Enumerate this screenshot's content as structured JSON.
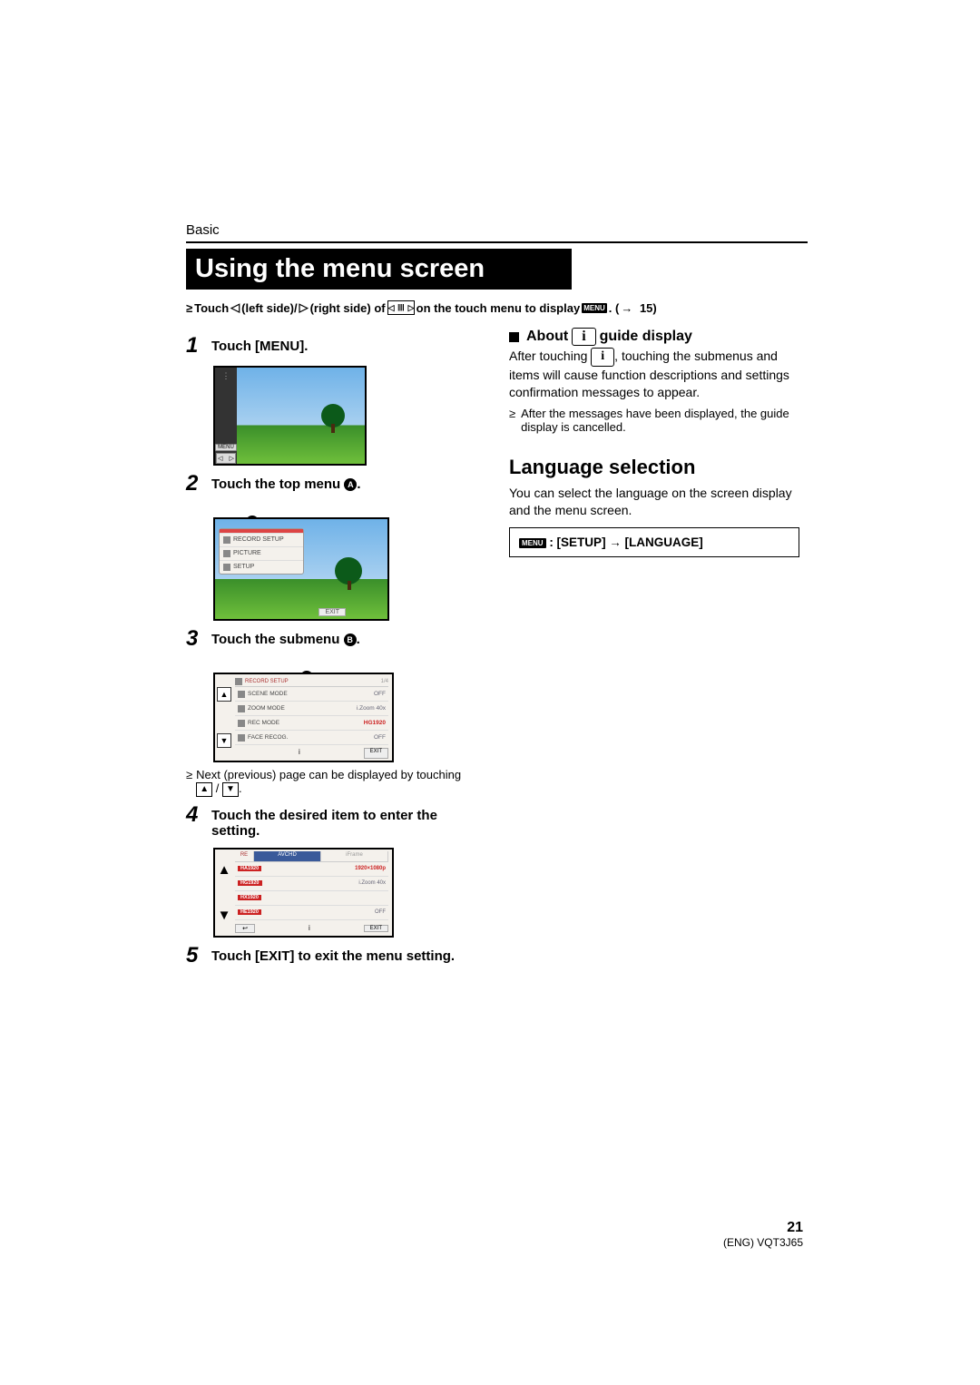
{
  "breadcrumb": "Basic",
  "title": "Using the menu screen",
  "intro": {
    "prefix": "Touch",
    "left": "(left side)/",
    "right": "(right side) of",
    "tail1": "on the touch menu to display",
    "tail2": ". (",
    "arrow": "→",
    "page_ref": "15)"
  },
  "steps": {
    "s1": {
      "num": "1",
      "text": "Touch [MENU]."
    },
    "s2": {
      "num": "2",
      "text_a": "Touch the top menu ",
      "badge": "A",
      "text_b": "."
    },
    "s3": {
      "num": "3",
      "text_a": "Touch the submenu ",
      "badge": "B",
      "text_b": ".",
      "note_a": "Next (previous) page can be displayed by touching ",
      "slash": " / ",
      "note_b": "."
    },
    "s4": {
      "num": "4",
      "text": "Touch the desired item to enter the setting."
    },
    "s5": {
      "num": "5",
      "text": "Touch [EXIT] to exit the menu setting."
    }
  },
  "fig1": {
    "menu": "MENU"
  },
  "fig2": {
    "marker": "A",
    "row1": "RECORD SETUP",
    "row2": "PICTURE",
    "row3": "SETUP",
    "exit": "EXIT"
  },
  "fig3": {
    "marker": "B",
    "header": "RECORD SETUP",
    "page": "1/4",
    "r1k": "SCENE MODE",
    "r1v": "OFF",
    "r2k": "ZOOM MODE",
    "r2v": "i.Zoom 40x",
    "r3k": "REC MODE",
    "r3v": "HG1920",
    "r4k": "FACE RECOG.",
    "r4v": "OFF",
    "info": "i",
    "exit": "EXIT"
  },
  "fig4": {
    "tab1": "RE",
    "tab2": "AVCHD",
    "tab3": "iFrame",
    "b1": "HA1920",
    "b1v": "1920×1080p",
    "b2": "HG1920",
    "b2v": "i.Zoom 40x",
    "b3": "HX1920",
    "b3v": "",
    "b4": "HE1920",
    "b4v": "OFF",
    "back": "↩",
    "info": "i",
    "exit": "EXIT"
  },
  "right": {
    "about_a": "About",
    "i": "i",
    "about_b": "guide display",
    "p1a": "After touching ",
    "p1b": ", touching the submenus and items will cause function descriptions and settings confirmation messages to appear.",
    "b1": "After the messages have been displayed, the guide display is cancelled.",
    "lang_title": "Language selection",
    "lang_desc": "You can select the language on the screen display and the menu screen.",
    "menu_word": "MENU",
    "path": " : [SETUP] → [LANGUAGE]"
  },
  "footer": {
    "page": "21",
    "code": "(ENG) VQT3J65"
  }
}
